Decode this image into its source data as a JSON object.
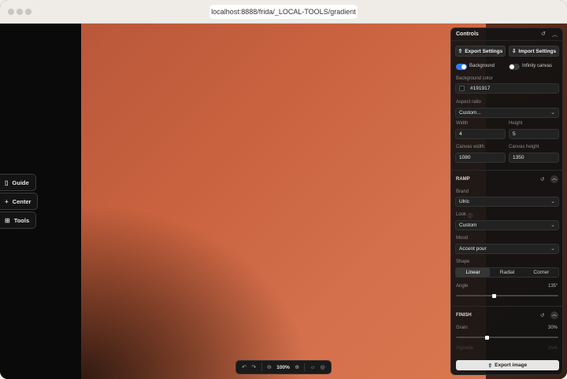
{
  "browser": {
    "url": "localhost:8888/frida/_LOCAL-TOOLS/gradient"
  },
  "left_buttons": [
    {
      "label": "Guide",
      "icon": "book-icon"
    },
    {
      "label": "Center",
      "icon": "plus-icon"
    },
    {
      "label": "Tools",
      "icon": "grid-icon"
    }
  ],
  "zoom": {
    "level": "100%"
  },
  "panel": {
    "title": "Controls",
    "export_settings": "Export Settings",
    "import_settings": "Import Settings",
    "background_toggle": "Background",
    "background_on": true,
    "infinity_toggle": "Infinity canvas",
    "infinity_on": false,
    "background_color_label": "Background color",
    "background_color_value": "#191917",
    "aspect_label": "Aspect ratio",
    "aspect_value": "Custom...",
    "width_label": "Width",
    "width_value": "4",
    "height_label": "Height",
    "height_value": "5",
    "canvas_width_label": "Canvas width",
    "canvas_width_value": "1080",
    "canvas_height_label": "Canvas height",
    "canvas_height_value": "1350",
    "ramp_title": "RAMP",
    "brand_label": "Brand",
    "brand_value": "Ulric",
    "look_label": "Look",
    "look_value": "Custom",
    "mood_label": "Mood",
    "mood_value": "Accent pour",
    "shape_label": "Shape",
    "shape_options": [
      "Linear",
      "Radial",
      "Corner"
    ],
    "shape_selected": "Linear",
    "angle_label": "Angle",
    "angle_value": "135°",
    "angle_fraction": 0.375,
    "finish_title": "FINISH",
    "grain_label": "Grain",
    "grain_value": "30%",
    "grain_fraction": 0.3,
    "vignette_label": "Vignette",
    "vignette_value": "25%",
    "export_image": "Export image"
  },
  "colors": {
    "accent_toggle": "#2f7cf6",
    "canvas_warm": "#d4704c"
  }
}
